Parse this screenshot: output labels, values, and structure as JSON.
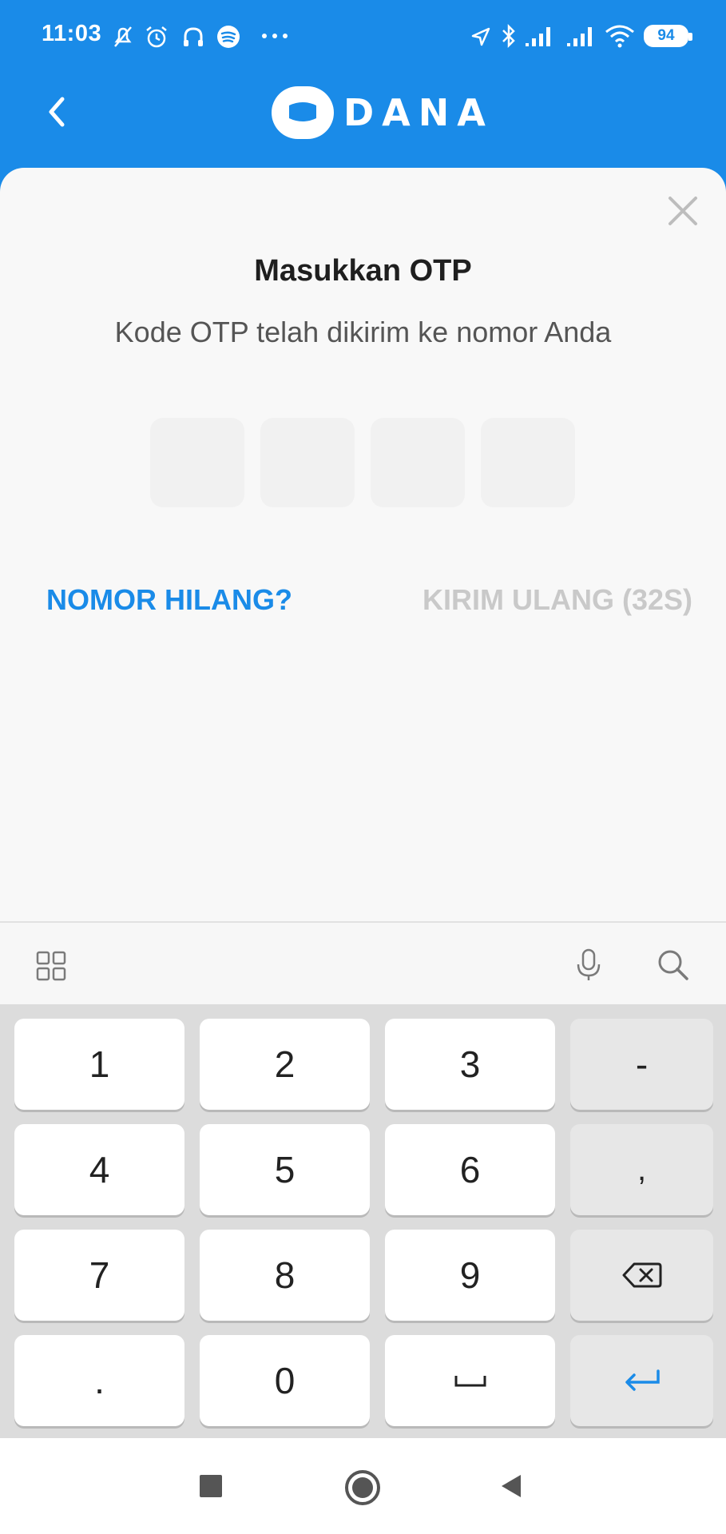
{
  "status_bar": {
    "time": "11:03",
    "battery": "94"
  },
  "header": {
    "logo_text": "DANA",
    "brand_color": "#1a8be8"
  },
  "otp": {
    "title": "Masukkan OTP",
    "subtitle": "Kode OTP telah dikirim ke nomor Anda",
    "digit_count": 4,
    "digits": [
      "",
      "",
      "",
      ""
    ],
    "lost_number_label": "NOMOR HILANG?",
    "resend_label": "KIRIM ULANG (32S)"
  },
  "keyboard": {
    "keys": [
      [
        "1",
        "2",
        "3",
        "-"
      ],
      [
        "4",
        "5",
        "6",
        ","
      ],
      [
        "7",
        "8",
        "9",
        "backspace-icon"
      ],
      [
        ".",
        "0",
        "space-icon",
        "enter-icon"
      ]
    ]
  },
  "icons": {
    "status": [
      "silent-icon",
      "alarm-icon",
      "headphones-icon",
      "spotify-icon",
      "more-icon",
      "location-icon",
      "bluetooth-icon",
      "signal-icon",
      "signal-icon",
      "wifi-icon"
    ],
    "toolbar": [
      "grid-icon",
      "mic-icon",
      "search-icon"
    ],
    "navigation": [
      "recent-apps-icon",
      "home-icon",
      "back-icon"
    ]
  }
}
